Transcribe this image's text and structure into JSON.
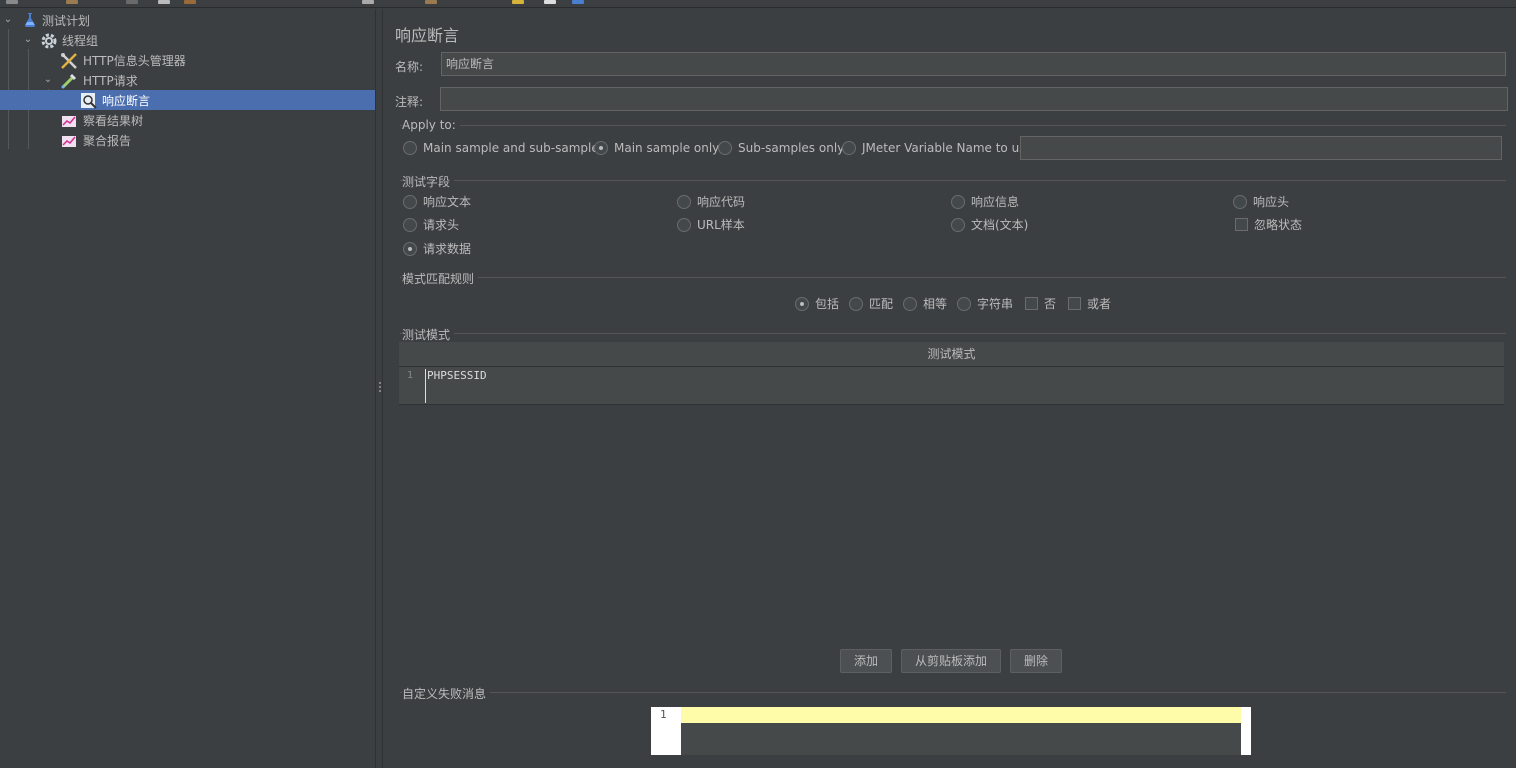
{
  "tree": {
    "items": [
      {
        "label": "测试计划",
        "icon": "flask-icon"
      },
      {
        "label": "线程组",
        "icon": "gear-icon"
      },
      {
        "label": "HTTP信息头管理器",
        "icon": "wrench-icon"
      },
      {
        "label": "HTTP请求",
        "icon": "pipette-icon"
      },
      {
        "label": "响应断言",
        "icon": "magnifier-icon"
      },
      {
        "label": "察看结果树",
        "icon": "graph-icon"
      },
      {
        "label": "聚合报告",
        "icon": "graph-icon"
      }
    ]
  },
  "panel": {
    "title": "响应断言",
    "name_label": "名称:",
    "name_value": "响应断言",
    "comment_label": "注释:",
    "comment_value": ""
  },
  "apply_to": {
    "title": "Apply to:",
    "options": [
      "Main sample and sub-samples",
      "Main sample only",
      "Sub-samples only",
      "JMeter Variable Name to use"
    ],
    "selected": "Main sample only",
    "variable_value": ""
  },
  "test_field": {
    "title": "测试字段",
    "options": [
      "响应文本",
      "响应代码",
      "响应信息",
      "响应头",
      "请求头",
      "URL样本",
      "文档(文本)",
      "忽略状态",
      "请求数据"
    ],
    "selected": "请求数据"
  },
  "pattern_rules": {
    "title": "模式匹配规则",
    "radios": [
      "包括",
      "匹配",
      "相等",
      "字符串"
    ],
    "selected": "包括",
    "checkboxes": [
      "否",
      "或者"
    ]
  },
  "patterns": {
    "title": "测试模式",
    "column_header": "测试模式",
    "rows": [
      {
        "line": "1",
        "value": "PHPSESSID"
      }
    ]
  },
  "buttons": {
    "add": "添加",
    "add_from_clipboard": "从剪贴板添加",
    "delete": "删除"
  },
  "failure_message": {
    "title": "自定义失败消息",
    "line": "1",
    "value": ""
  },
  "colors": {
    "background": "#3c3f41",
    "selection": "#4b6eaf",
    "input_bg": "#45494a",
    "highlight_line": "#fefca8"
  }
}
